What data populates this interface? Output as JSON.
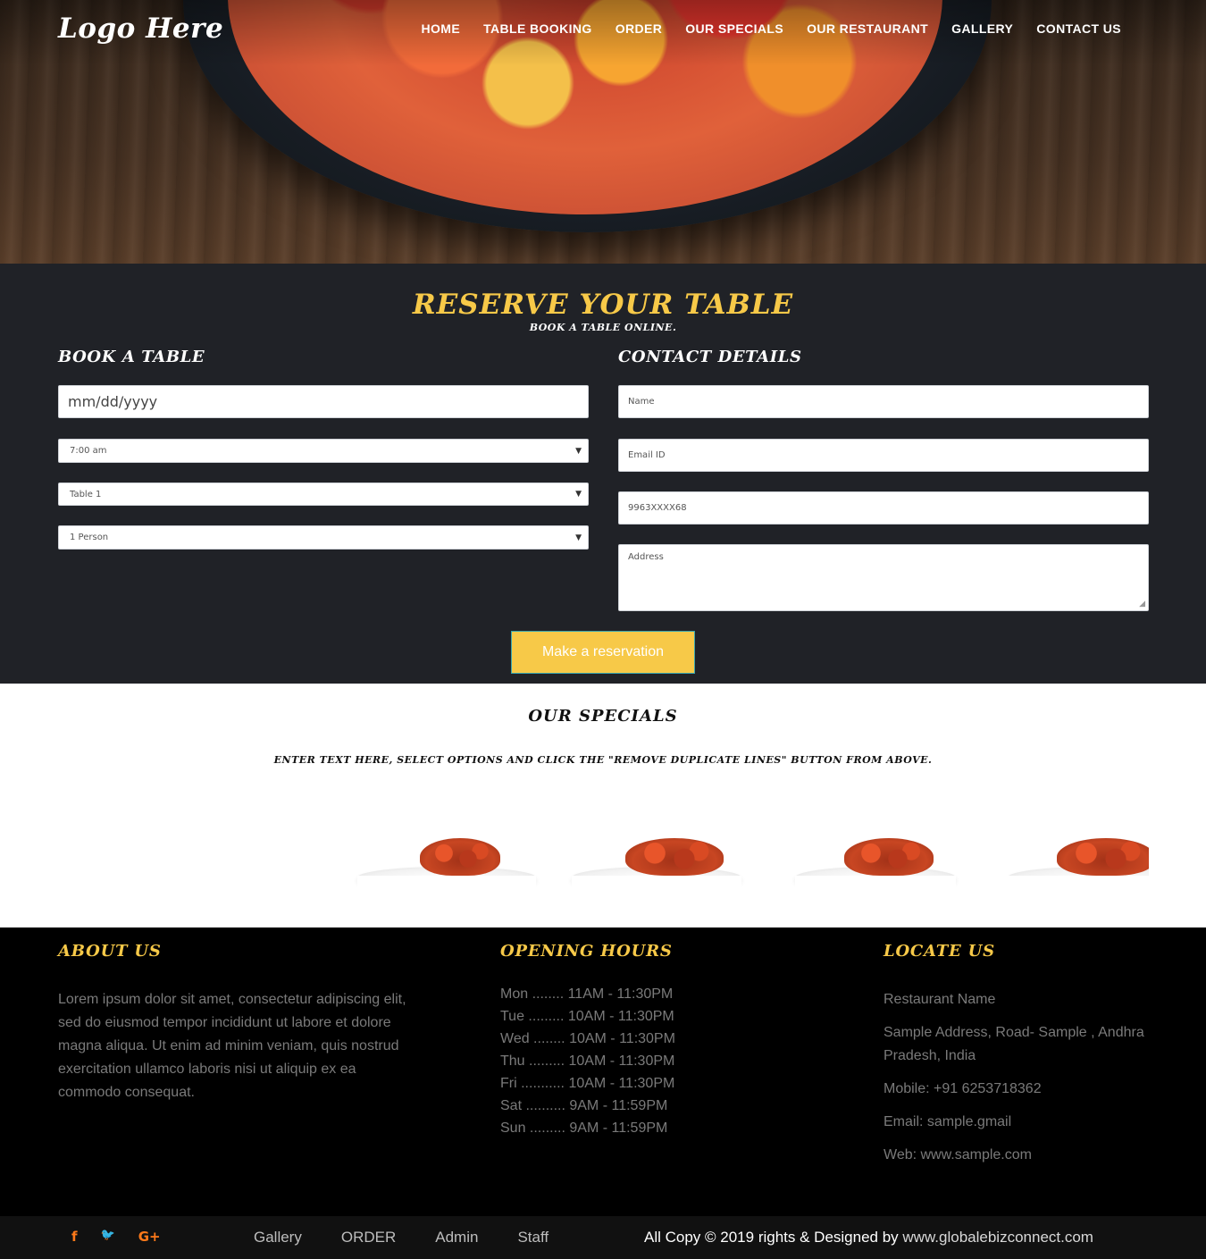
{
  "header": {
    "logo_prefix": "Logo",
    "logo_suffix": "Here",
    "nav": [
      "HOME",
      "TABLE BOOKING",
      "ORDER",
      "OUR SPECIALS",
      "OUR RESTAURANT",
      "GALLERY",
      "CONTACT US"
    ]
  },
  "reservation": {
    "title": "RESERVE YOUR TABLE",
    "subtitle": "BOOK A TABLE ONLINE.",
    "book_heading": "BOOK A TABLE",
    "contact_heading": "CONTACT DETAILS",
    "date_placeholder": "mm/dd/yyyy",
    "time_value": "7:00 am",
    "table_value": "Table 1",
    "persons_value": "1 Person",
    "name_placeholder": "Name",
    "email_placeholder": "Email ID",
    "phone_placeholder": "9963XXXX68",
    "address_placeholder": "Address",
    "submit_label": "Make a reservation"
  },
  "specials": {
    "title": "OUR SPECIALS",
    "text": "ENTER TEXT HERE, SELECT OPTIONS AND CLICK THE \"REMOVE DUPLICATE LINES\" BUTTON FROM ABOVE."
  },
  "footer": {
    "about_heading": "ABOUT US",
    "about_text": "Lorem ipsum dolor sit amet, consectetur adipiscing elit, sed do eiusmod tempor incididunt ut labore et dolore magna aliqua. Ut enim ad minim veniam, quis nostrud exercitation ullamco laboris nisi ut aliquip ex ea commodo consequat.",
    "hours_heading": "OPENING HOURS",
    "hours": [
      "Mon ........ 11AM - 11:30PM",
      "Tue ......... 10AM - 11:30PM",
      "Wed ........ 10AM - 11:30PM",
      "Thu ......... 10AM - 11:30PM",
      "Fri ........... 10AM - 11:30PM",
      "Sat .......... 9AM - 11:59PM",
      "Sun ......... 9AM - 11:59PM"
    ],
    "locate_heading": "LOCATE US",
    "restaurant_name": "Restaurant Name",
    "address": "Sample Address, Road- Sample , Andhra Pradesh, India",
    "mobile": "Mobile: +91 6253718362",
    "email": "Email: sample.gmail",
    "web": "Web: www.sample.com"
  },
  "bottom_bar": {
    "social_icons": [
      "facebook-icon",
      "twitter-icon",
      "google-plus-icon"
    ],
    "social_glyphs": [
      "f",
      "🐦",
      "G+"
    ],
    "links": [
      "Gallery",
      "ORDER",
      "Admin",
      "Staff"
    ],
    "copyright_text": "All Copy © 2019 rights & Designed by ",
    "copyright_link": "www.globalebizconnect.com"
  },
  "colors": {
    "accent": "#f7c948",
    "reserve_bg": "#202227",
    "footer_bg": "#000000",
    "social": "#ff7a1a"
  }
}
